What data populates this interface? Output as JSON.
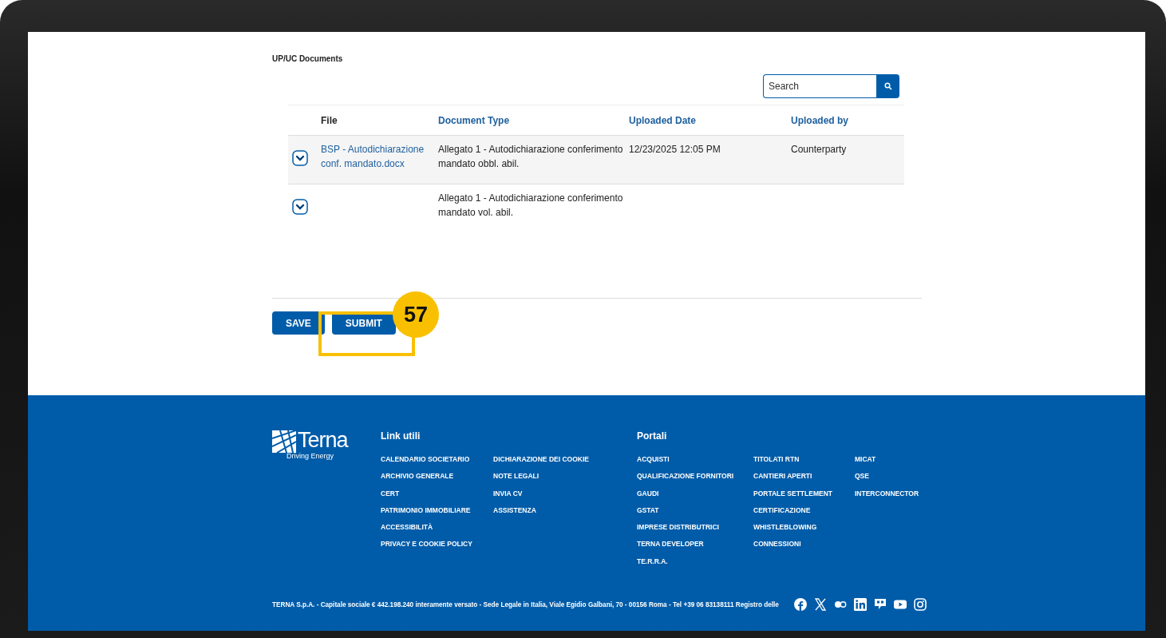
{
  "section": {
    "title": "UP/UC Documents"
  },
  "search": {
    "placeholder": "Search"
  },
  "table": {
    "columns": [
      "File",
      "Document Type",
      "Uploaded Date",
      "Uploaded by"
    ],
    "rows": [
      {
        "file": "BSP - Autodichiarazione conf. mandato.docx",
        "document_type": "Allegato 1 - Autodichiarazione conferimento mandato obbl. abil.",
        "uploaded_date": "12/23/2025 12:05 PM",
        "uploaded_by": "Counterparty"
      },
      {
        "file": "",
        "document_type": "Allegato 1 - Autodichiarazione conferimento mandato vol. abil.",
        "uploaded_date": "",
        "uploaded_by": ""
      }
    ]
  },
  "buttons": [
    "SAVE",
    "SUBMIT"
  ],
  "annotation": {
    "number": "57"
  },
  "footer": {
    "logo": {
      "name": "Terna",
      "tagline": "Driving Energy"
    },
    "link_groups": [
      {
        "title": "Link utili",
        "columns": [
          [
            "CALENDARIO SOCIETARIO",
            "ARCHIVIO GENERALE",
            "CERT",
            "PATRIMONIO IMMOBILIARE",
            "ACCESSIBILITÀ",
            "PRIVACY E COOKIE POLICY"
          ],
          [
            "DICHIARAZIONE DEI COOKIE",
            "NOTE LEGALI",
            "INVIA CV",
            "ASSISTENZA"
          ]
        ]
      },
      {
        "title": "Portali",
        "columns": [
          [
            "ACQUISTI",
            "QUALIFICAZIONE FORNITORI",
            "GAUDI",
            "GSTAT",
            "IMPRESE DISTRIBUTRICI",
            "TERNA DEVELOPER",
            "TE.R.R.A."
          ],
          [
            "TITOLATI RTN",
            "CANTIERI APERTI",
            "PORTALE SETTLEMENT",
            "CERTIFICAZIONE",
            "WHISTLEBLOWING",
            "CONNESSIONI"
          ],
          [
            "MICAT",
            "QSE",
            "INTERCONNECTOR"
          ]
        ]
      }
    ],
    "legal": "TERNA S.p.A. - Capitale sociale € 442.198.240 interamente versato - Sede Legale in Italia, Viale Egidio Galbani, 70 - 00156 Roma - Tel +39 06 83138111 Registro delle"
  }
}
